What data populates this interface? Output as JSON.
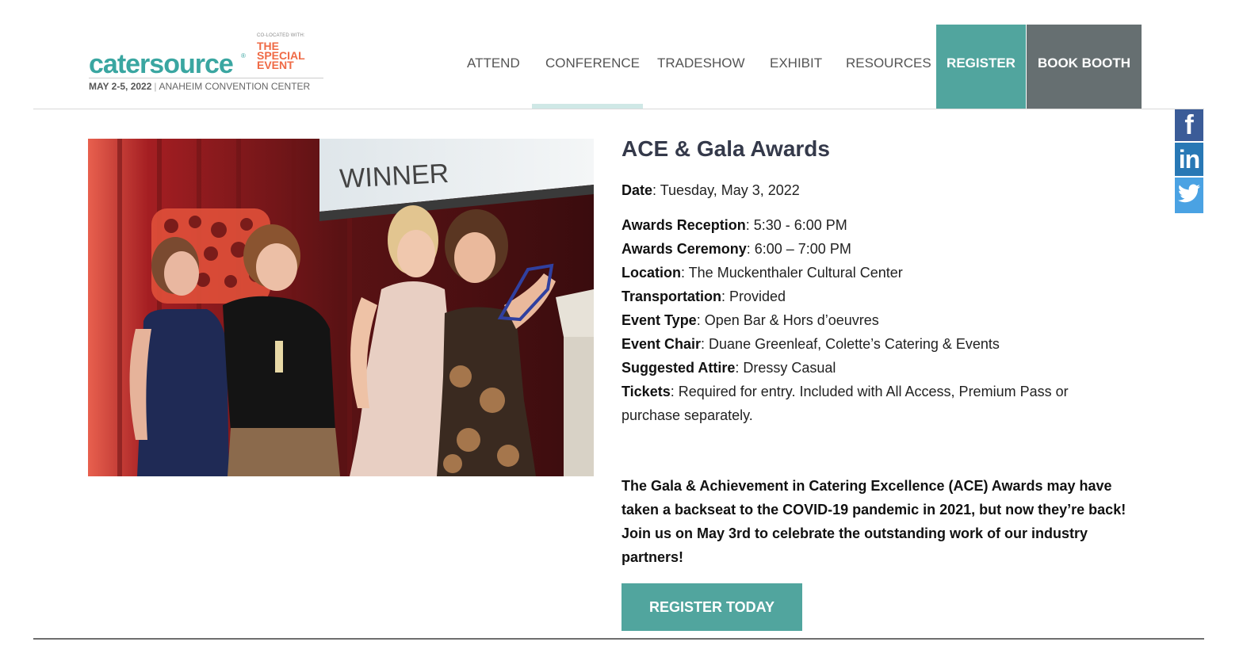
{
  "logo": {
    "wordmark": "catersource",
    "registered": "®",
    "colocated": "CO-LOCATED WITH:",
    "special_lines": [
      "THE",
      "SPECIAL",
      "EVENT"
    ],
    "dates": "MAY 2-5, 2022",
    "separator": "|",
    "venue": "ANAHEIM CONVENTION CENTER"
  },
  "nav": {
    "items": [
      "ATTEND",
      "CONFERENCE",
      "TRADESHOW",
      "EXHIBIT",
      "RESOURCES"
    ],
    "active": "CONFERENCE",
    "register": "REGISTER",
    "book_booth": "BOOK BOOTH"
  },
  "social": {
    "facebook": "f",
    "linkedin": "in",
    "icons": [
      "facebook-icon",
      "linkedin-icon",
      "twitter-icon"
    ]
  },
  "photo": {
    "sign_text": "WINNER"
  },
  "event": {
    "title": "ACE & Gala Awards",
    "date_label": "Date",
    "date_value": ": Tuesday, May 3, 2022",
    "details": [
      {
        "label": "Awards Reception",
        "value": ": 5:30 - 6:00 PM"
      },
      {
        "label": "Awards Ceremony",
        "value": ":  6:00 – 7:00 PM"
      },
      {
        "label": "Location",
        "value": ": The Muckenthaler Cultural Center"
      },
      {
        "label": "Transportation",
        "value": ": Provided"
      },
      {
        "label": "Event Type",
        "value": ": Open Bar & Hors d’oeuvres"
      },
      {
        "label": "Event Chair",
        "value": ": Duane Greenleaf, Colette’s Catering & Events"
      },
      {
        "label": "Suggested Attire",
        "value": ": Dressy Casual"
      }
    ],
    "tickets_label": "Tickets",
    "tickets_value": ": Required for entry. Included with All Access, Premium Pass or purchase separately.",
    "description": "The Gala & Achievement in Catering Excellence (ACE) Awards may have taken a backseat to the COVID-19 pandemic in 2021, but now they’re back!  Join us on May 3rd to celebrate the outstanding work of our industry partners!",
    "cta": "REGISTER TODAY"
  },
  "colors": {
    "teal": "#51a59e",
    "gray_button": "#666f71",
    "logo_teal": "#3aa6a1",
    "logo_orange": "#ef6a45",
    "title": "#34394a"
  }
}
